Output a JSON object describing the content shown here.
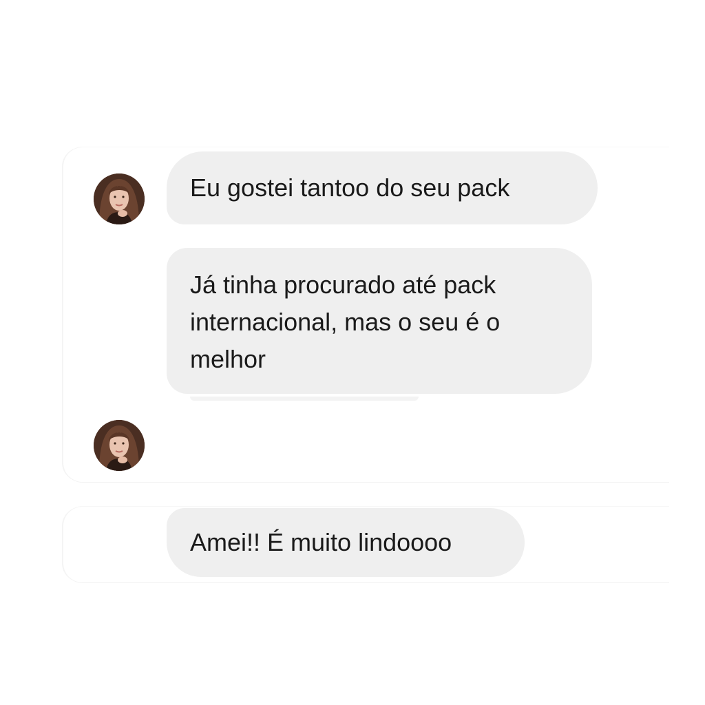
{
  "chat": {
    "messages": [
      {
        "sender": "contact",
        "text": "Eu gostei tantoo do seu pack"
      },
      {
        "sender": "contact",
        "text": "Já tinha procurado até pack internacional, mas o seu é o melhor"
      },
      {
        "sender": "contact",
        "text": "Amei!! É muito lindoooo"
      }
    ]
  },
  "avatar": {
    "icon": "profile-photo-icon"
  },
  "colors": {
    "background": "#ffffff",
    "bubble": "#efefef",
    "text": "#1a1a1a"
  }
}
